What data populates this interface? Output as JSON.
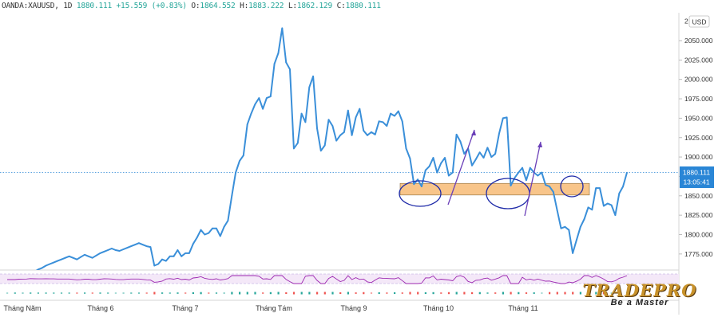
{
  "header": {
    "symbol": "OANDA:XAUUSD, 1D",
    "last": "1880.111",
    "change": "+15.559 (+0.83%)",
    "o_label": "O:",
    "o_value": "1864.552",
    "h_label": "H:",
    "h_value": "1883.222",
    "l_label": "L:",
    "l_value": "1862.129",
    "c_label": "C:",
    "c_value": "1880.111"
  },
  "currency_button": "USD",
  "price_badge": {
    "price": "1880.111",
    "countdown": "13:05:41"
  },
  "colors": {
    "line": "#3a8fd9",
    "zone_fill": "#f8c58a",
    "annotation": "#1e2aa8",
    "badge": "#2a86d6",
    "oscillator_line": "#9c27b0"
  },
  "brand": {
    "name": "TRADEPRO",
    "tagline": "Be a Master"
  },
  "chart_data": {
    "type": "line",
    "title": "",
    "xlabel": "",
    "ylabel": "",
    "ylim": [
      1762,
      2080
    ],
    "y_ticks": [
      "2050.000",
      "2025.000",
      "2000.000",
      "1975.000",
      "1950.000",
      "1925.000",
      "1900.000",
      "1875.000",
      "1850.000",
      "1825.000",
      "1800.000",
      "1775.000"
    ],
    "y_tick_values": [
      2050,
      2025,
      2000,
      1975,
      1950,
      1925,
      1900,
      1875,
      1850,
      1825,
      1800,
      1775
    ],
    "top_tick_partial": "2",
    "x_month_labels": [
      {
        "label": "Tháng Năm",
        "index": 0
      },
      {
        "label": "Tháng 6",
        "index": 22
      },
      {
        "label": "Tháng 7",
        "index": 43
      },
      {
        "label": "Tháng Tám",
        "index": 64
      },
      {
        "label": "Tháng 9",
        "index": 86
      },
      {
        "label": "Tháng 10",
        "index": 107
      },
      {
        "label": "Tháng 11",
        "index": 129
      }
    ],
    "series": [
      {
        "values": [
          1736,
          1739,
          1742,
          1740,
          1744,
          1748,
          1750,
          1752,
          1755,
          1757,
          1760,
          1762,
          1764,
          1766,
          1768,
          1770,
          1772,
          1770,
          1768,
          1771,
          1774,
          1772,
          1770,
          1773,
          1776,
          1778,
          1780,
          1782,
          1780,
          1779,
          1781,
          1783,
          1785,
          1787,
          1789,
          1787,
          1785,
          1784,
          1760,
          1762,
          1768,
          1766,
          1772,
          1772,
          1780,
          1772,
          1776,
          1776,
          1788,
          1796,
          1806,
          1800,
          1802,
          1808,
          1808,
          1798,
          1810,
          1818,
          1850,
          1880,
          1895,
          1902,
          1942,
          1956,
          1968,
          1976,
          1962,
          1976,
          1978,
          2020,
          2034,
          2066,
          2022,
          2013,
          1911,
          1918,
          1956,
          1945,
          1990,
          2004,
          1937,
          1908,
          1915,
          1948,
          1940,
          1921,
          1928,
          1932,
          1960,
          1928,
          1951,
          1962,
          1934,
          1928,
          1932,
          1929,
          1946,
          1945,
          1940,
          1956,
          1953,
          1959,
          1946,
          1911,
          1898,
          1865,
          1871,
          1862,
          1883,
          1888,
          1899,
          1880,
          1892,
          1899,
          1876,
          1880,
          1929,
          1920,
          1904,
          1911,
          1889,
          1897,
          1906,
          1899,
          1912,
          1900,
          1904,
          1930,
          1950,
          1951,
          1863,
          1873,
          1880,
          1886,
          1870,
          1886,
          1880,
          1876,
          1880,
          1864,
          1862,
          1855,
          1831,
          1808,
          1810,
          1806,
          1776,
          1793,
          1810,
          1820,
          1835,
          1832,
          1860,
          1860,
          1837,
          1840,
          1838,
          1825,
          1853,
          1862,
          1880
        ]
      }
    ],
    "annotations": {
      "support_zone": [
        1851,
        1866
      ],
      "current_price_line": 1880.111
    },
    "grid": false,
    "legend": "none"
  }
}
